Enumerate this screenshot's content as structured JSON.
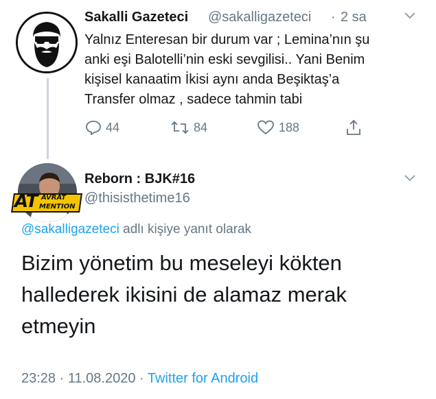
{
  "tweet1": {
    "display_name": "Sakalli Gazeteci",
    "handle": "@sakalligazeteci",
    "separator": "·",
    "time": "2 sa",
    "text_lines": [
      "Yalnız Enteresan bir durum var ; Lemina’nın şu",
      "anki eşi Balotelli’nin eski sevgilisi.. Yani Benim",
      "kişisel kanaatim İkisi aynı anda Beşiktaş’a",
      "Transfer olmaz , sadece tahmin tabi"
    ],
    "replies": "44",
    "retweets": "84",
    "likes": "188"
  },
  "tweet2": {
    "display_name": "Reborn : BJK#16",
    "handle": "@thisisthetime16",
    "reply_to_mention": "@sakalligazeteci",
    "reply_to_suffix": "adlı kişiye yanıt olarak",
    "text_lines": [
      "Bizim yönetim bu meseleyi kökten",
      "hallederek ikisini de alamaz merak",
      "etmeyin"
    ],
    "time": "23:28",
    "date": "11.08.2020",
    "separator": "·",
    "source": "Twitter for Android"
  },
  "avatar_badge": {
    "big": "AT",
    "top": "AVRAT",
    "bottom": "MENTION"
  },
  "colors": {
    "accent": "#1da1f2",
    "secondary_text": "#657786",
    "badge": "#f5c400"
  },
  "icons": [
    "reply-icon",
    "retweet-icon",
    "like-icon",
    "share-icon",
    "chevron-down-icon"
  ]
}
